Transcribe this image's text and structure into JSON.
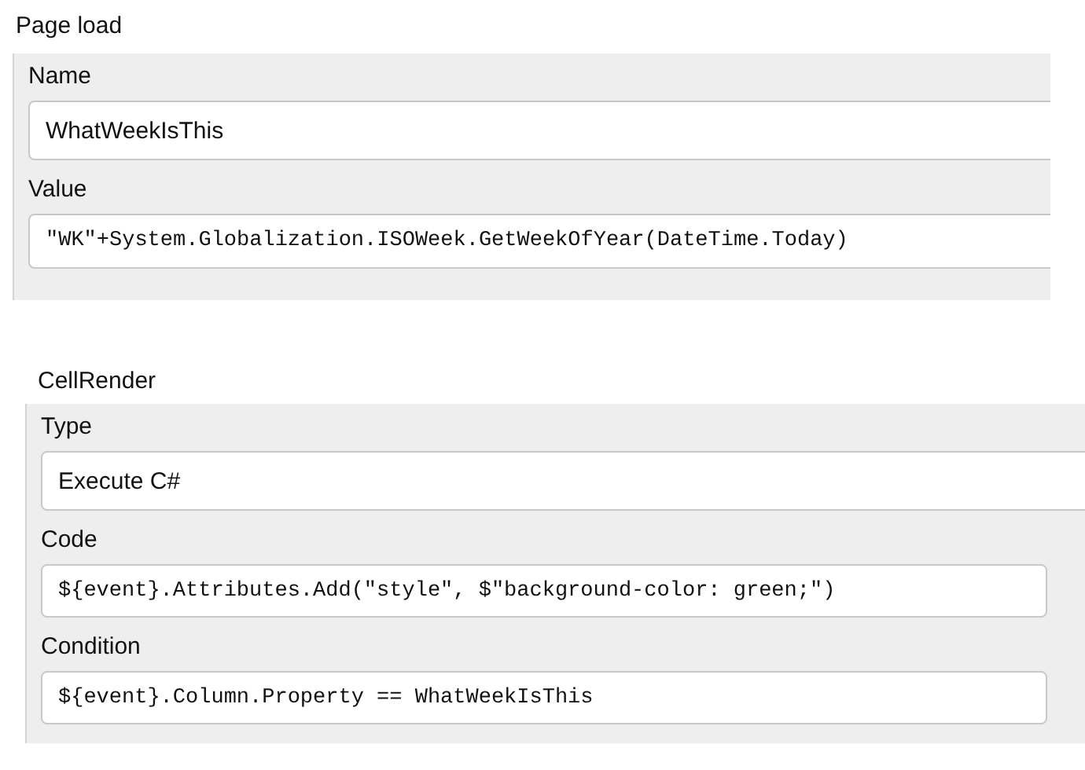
{
  "sections": [
    {
      "title": "Page load",
      "fields": [
        {
          "label": "Name",
          "kind": "text",
          "value": "WhatWeekIsThis"
        },
        {
          "label": "Value",
          "kind": "code",
          "value": "\"WK\"+System.Globalization.ISOWeek.GetWeekOfYear(DateTime.Today)"
        }
      ]
    },
    {
      "title": "CellRender",
      "fields": [
        {
          "label": "Type",
          "kind": "text",
          "value": "Execute C#"
        },
        {
          "label": "Code",
          "kind": "code",
          "value": "${event}.Attributes.Add(\"style\", $\"background-color: green;\")"
        },
        {
          "label": "Condition",
          "kind": "code",
          "value": "${event}.Column.Property == WhatWeekIsThis"
        }
      ]
    }
  ]
}
